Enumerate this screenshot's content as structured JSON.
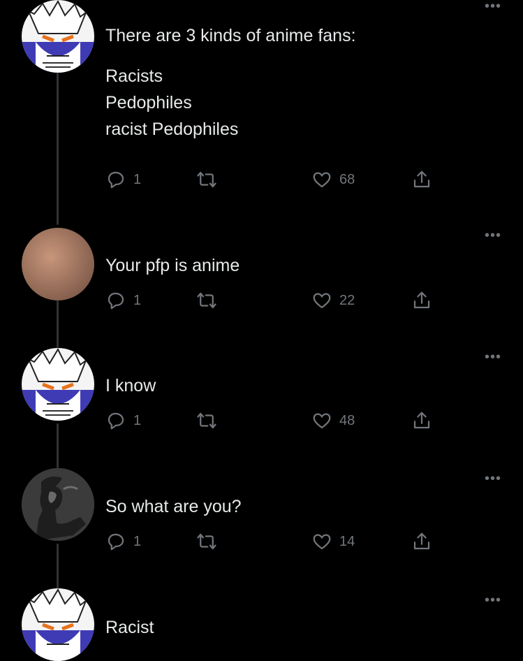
{
  "tweets": [
    {
      "avatar": "vegeta-avatar",
      "text_lines": [
        "There are 3 kinds of anime fans:",
        "",
        "Racists",
        "Pedophiles",
        "racist Pedophiles"
      ],
      "replies": "1",
      "likes": "68"
    },
    {
      "avatar": "beige-avatar",
      "text_lines": [
        "Your pfp is anime"
      ],
      "replies": "1",
      "likes": "22"
    },
    {
      "avatar": "vegeta-avatar",
      "text_lines": [
        "I know"
      ],
      "replies": "1",
      "likes": "48"
    },
    {
      "avatar": "dark-figure-avatar",
      "text_lines": [
        "So what are you?"
      ],
      "replies": "1",
      "likes": "14"
    },
    {
      "avatar": "vegeta-avatar",
      "text_lines": [
        "Racist"
      ],
      "replies": "",
      "likes": ""
    }
  ],
  "more_glyph": "•••",
  "colors": {
    "background": "#000000",
    "text": "#e7e9ea",
    "muted": "#71767b",
    "thread_line": "#2f3336"
  }
}
